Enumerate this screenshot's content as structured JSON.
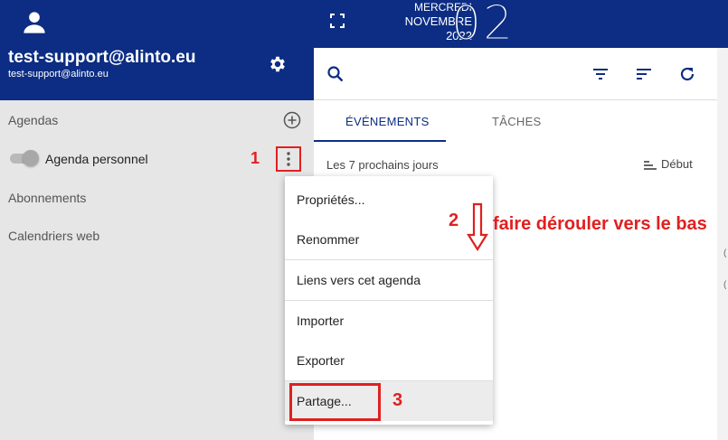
{
  "sidebar": {
    "user_email": "test-support@alinto.eu",
    "user_sub": "test-support@alinto.eu",
    "sections": {
      "agendas": "Agendas",
      "abonnements": "Abonnements",
      "calendriers_web": "Calendriers web"
    },
    "agenda_item": {
      "label": "Agenda personnel",
      "enabled": true
    }
  },
  "topbar": {
    "weekday": "MERCREDI",
    "month": "NOVEMBRE",
    "year": "2022",
    "day": "02"
  },
  "main": {
    "tabs": [
      {
        "label": "ÉVÉNEMENTS",
        "active": true
      },
      {
        "label": "TÂCHES",
        "active": false
      }
    ],
    "range_label": "Les 7 prochains jours",
    "sort_label": "Début"
  },
  "menu": {
    "items": [
      "Propriétés...",
      "Renommer",
      "Liens vers cet agenda",
      "Importer",
      "Exporter",
      "Partage..."
    ]
  },
  "annotations": {
    "step1": "1",
    "step2": "2",
    "step3": "3",
    "instruction": "faire dérouler vers le bas"
  },
  "colors": {
    "brand": "#0c2d83",
    "annotation": "#e02020"
  }
}
